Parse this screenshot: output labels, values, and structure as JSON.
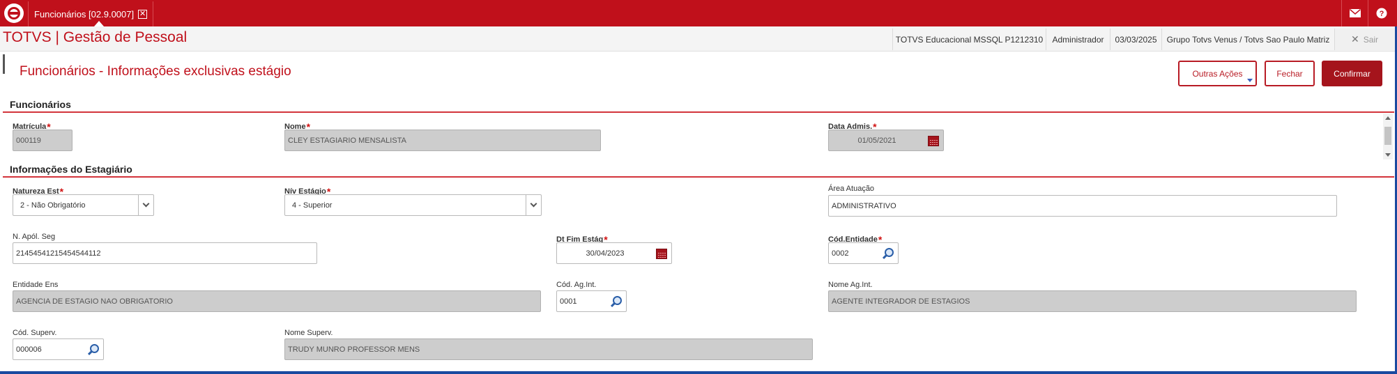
{
  "topbar": {
    "tab_label": "Funcionários [02.9.0007]",
    "tab_close": "✕",
    "mail_icon": "mail-icon",
    "help_icon": "help-icon"
  },
  "header": {
    "app_title": "TOTVS | Gestão de Pessoal",
    "environment": "TOTVS Educacional MSSQL P1212310",
    "user": "Administrador",
    "date": "03/03/2025",
    "company": "Grupo Totvs Venus / Totvs Sao Paulo Matriz",
    "logout_label": "Sair"
  },
  "page": {
    "title": "Funcionários - Informações exclusivas estágio",
    "buttons": {
      "other_actions": "Outras Ações",
      "close": "Fechar",
      "confirm": "Confirmar"
    }
  },
  "sections": {
    "employees": "Funcionários",
    "intern_info": "Informações do Estagiário"
  },
  "fields": {
    "matricula": {
      "label": "Matrícula",
      "value": "000119"
    },
    "nome": {
      "label": "Nome",
      "value": "CLEY ESTAGIARIO MENSALISTA"
    },
    "data_admis": {
      "label": "Data Admis.",
      "value": "01/05/2021"
    },
    "natureza_est": {
      "label": "Natureza Est",
      "value": "2 - Não Obrigatório"
    },
    "niv_estagio": {
      "label": "Nív Estágio",
      "value": "4 - Superior"
    },
    "area_atuacao": {
      "label": "Área Atuação",
      "value": "ADMINISTRATIVO"
    },
    "n_apol_seg": {
      "label": "N. Apól. Seg",
      "value": "21454541215454544112"
    },
    "dt_fim_estag": {
      "label": "Dt Fim Estág",
      "value": "30/04/2023"
    },
    "cod_entidade": {
      "label": "Cód.Entidade",
      "value": "0002"
    },
    "entidade_ens": {
      "label": "Entidade Ens",
      "value": "AGENCIA DE ESTAGIO NAO OBRIGATORIO"
    },
    "cod_ag_int": {
      "label": "Cód. Ag.Int.",
      "value": "0001"
    },
    "nome_ag_int": {
      "label": "Nome Ag.Int.",
      "value": "AGENTE INTEGRADOR DE ESTAGIOS"
    },
    "cod_superv": {
      "label": "Cód. Superv.",
      "value": "000006"
    },
    "nome_superv": {
      "label": "Nome Superv.",
      "value": "TRUDY MUNRO PROFESSOR MENS"
    }
  },
  "required_mark": "*",
  "colors": {
    "brand_red": "#c0101b",
    "button_red": "#a5141c",
    "readonly_bg": "#cdcdcd"
  }
}
